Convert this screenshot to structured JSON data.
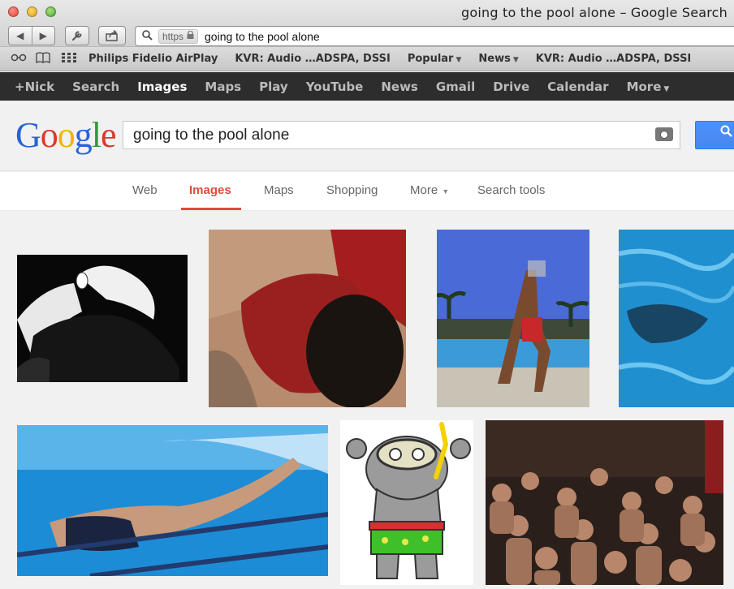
{
  "window": {
    "title": "going to the pool alone – Google Search"
  },
  "toolbar": {
    "back_icon": "◀",
    "forward_icon": "▶",
    "url_scheme": "https",
    "url_text": "going to the pool alone"
  },
  "bookmarks": {
    "items": [
      {
        "label": "Philips Fidelio AirPlay",
        "has_menu": false
      },
      {
        "label": "KVR: Audio …ADSPA, DSSI",
        "has_menu": false
      },
      {
        "label": "Popular",
        "has_menu": true
      },
      {
        "label": "News",
        "has_menu": true
      },
      {
        "label": "KVR: Audio …ADSPA, DSSI",
        "has_menu": false
      }
    ]
  },
  "gbar": {
    "items": [
      {
        "label": "+Nick",
        "active": false
      },
      {
        "label": "Search",
        "active": false
      },
      {
        "label": "Images",
        "active": true
      },
      {
        "label": "Maps",
        "active": false
      },
      {
        "label": "Play",
        "active": false
      },
      {
        "label": "YouTube",
        "active": false
      },
      {
        "label": "News",
        "active": false
      },
      {
        "label": "Gmail",
        "active": false
      },
      {
        "label": "Drive",
        "active": false
      },
      {
        "label": "Calendar",
        "active": false
      },
      {
        "label": "More",
        "active": false
      }
    ]
  },
  "logo": {
    "letters": [
      "G",
      "o",
      "o",
      "g",
      "l",
      "e"
    ],
    "colors": [
      "#2a62d6",
      "#d93a2b",
      "#f0b400",
      "#2a62d6",
      "#2f9a3a",
      "#d93a2b"
    ]
  },
  "search": {
    "query": "going to the pool alone"
  },
  "tabs": {
    "web": "Web",
    "images": "Images",
    "maps": "Maps",
    "shopping": "Shopping",
    "more": "More",
    "search_tools": "Search tools"
  },
  "colors": {
    "accent_red": "#dd4b39",
    "gbar_bg": "#2d2d2d",
    "search_blue": "#4d90fe"
  }
}
